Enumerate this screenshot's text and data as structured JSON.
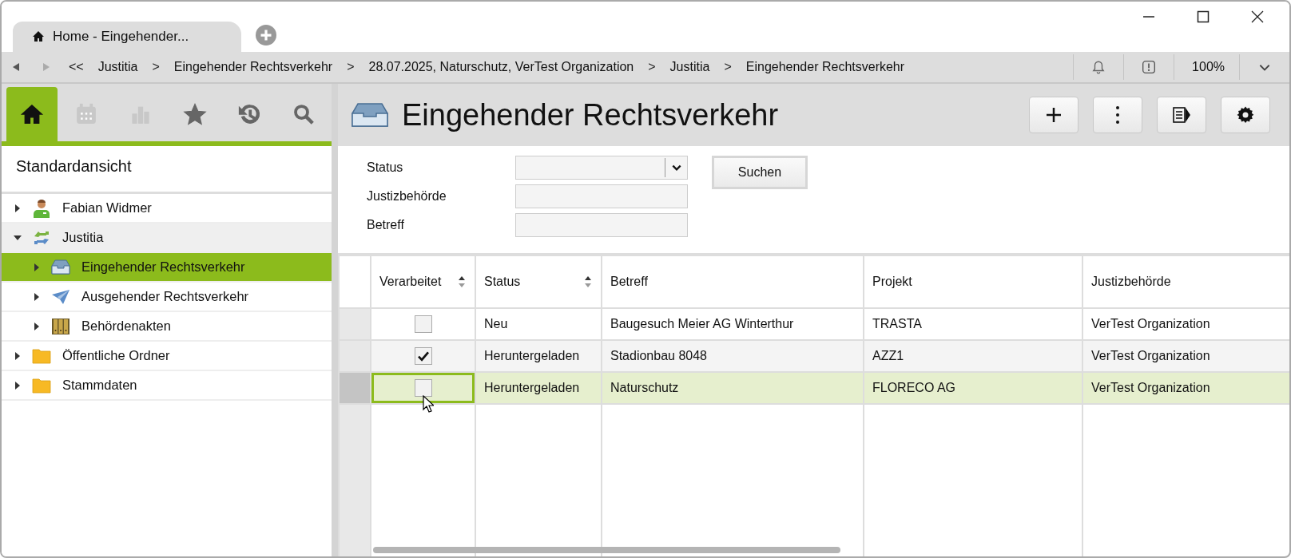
{
  "window": {
    "tab_title": "Home - Eingehender..."
  },
  "breadcrumb": [
    {
      "kind": "back",
      "text": "<<"
    },
    {
      "kind": "link",
      "text": "Justitia"
    },
    {
      "kind": "sep",
      "text": ">"
    },
    {
      "kind": "link",
      "text": "Eingehender Rechtsverkehr"
    },
    {
      "kind": "sep",
      "text": ">"
    },
    {
      "kind": "link",
      "text": "28.07.2025, Naturschutz, VerTest Organization"
    },
    {
      "kind": "sep",
      "text": ">"
    },
    {
      "kind": "link",
      "text": "Justitia"
    },
    {
      "kind": "sep",
      "text": ">"
    },
    {
      "kind": "link",
      "text": "Eingehender Rechtsverkehr"
    }
  ],
  "zoom": "100%",
  "sidebar": {
    "tabs": [
      {
        "kind": "home",
        "selected": true,
        "disabled": false
      },
      {
        "kind": "calendar",
        "selected": false,
        "disabled": true
      },
      {
        "kind": "chart",
        "selected": false,
        "disabled": true
      },
      {
        "kind": "star",
        "selected": false,
        "disabled": false
      },
      {
        "kind": "history",
        "selected": false,
        "disabled": false
      },
      {
        "kind": "search",
        "selected": false,
        "disabled": false
      }
    ],
    "title": "Standardansicht",
    "tree": [
      {
        "label": "Fabian Widmer",
        "kind": "person",
        "expanded": false,
        "selected": false
      },
      {
        "label": "Justitia",
        "kind": "exchange",
        "expanded": true,
        "selected": false,
        "children": [
          {
            "label": "Eingehender Rechtsverkehr",
            "kind": "inbox",
            "expanded": false,
            "selected": true
          },
          {
            "label": "Ausgehender Rechtsverkehr",
            "kind": "plane",
            "expanded": false,
            "selected": false
          },
          {
            "label": "Behördenakten",
            "kind": "binders",
            "expanded": false,
            "selected": false
          }
        ]
      },
      {
        "label": "Öffentliche Ordner",
        "kind": "folder",
        "expanded": false,
        "selected": false
      },
      {
        "label": "Stammdaten",
        "kind": "folder",
        "expanded": false,
        "selected": false
      }
    ]
  },
  "page": {
    "title": "Eingehender Rechtsverkehr",
    "toolbar": [
      {
        "kind": "plus"
      },
      {
        "kind": "more"
      },
      {
        "kind": "panel"
      },
      {
        "kind": "settings"
      }
    ]
  },
  "filters": [
    {
      "label": "Status",
      "kind": "dropdown"
    },
    {
      "label": "Justizbehörde",
      "kind": "text"
    },
    {
      "label": "Betreff",
      "kind": "text"
    }
  ],
  "search_button": "Suchen",
  "table": {
    "columns": [
      {
        "label": "Verarbeitet",
        "sortable": true
      },
      {
        "label": "Status",
        "sortable": true
      },
      {
        "label": "Betreff",
        "sortable": false
      },
      {
        "label": "Projekt",
        "sortable": false
      },
      {
        "label": "Justizbehörde",
        "sortable": false
      }
    ],
    "rows": [
      {
        "selected": false,
        "cells": [
          {
            "kind": "checkbox",
            "checked": false
          },
          "Neu",
          "Baugesuch Meier AG Winterthur",
          "TRASTA",
          "VerTest Organization"
        ]
      },
      {
        "selected": false,
        "cells": [
          {
            "kind": "checkbox",
            "checked": true
          },
          "Heruntergeladen",
          "Stadionbau 8048",
          "AZZ1",
          "VerTest Organization"
        ]
      },
      {
        "selected": true,
        "cells": [
          {
            "kind": "checkbox",
            "checked": false
          },
          "Heruntergeladen",
          "Naturschutz",
          "FLORECO AG",
          "VerTest Organization"
        ]
      }
    ]
  }
}
